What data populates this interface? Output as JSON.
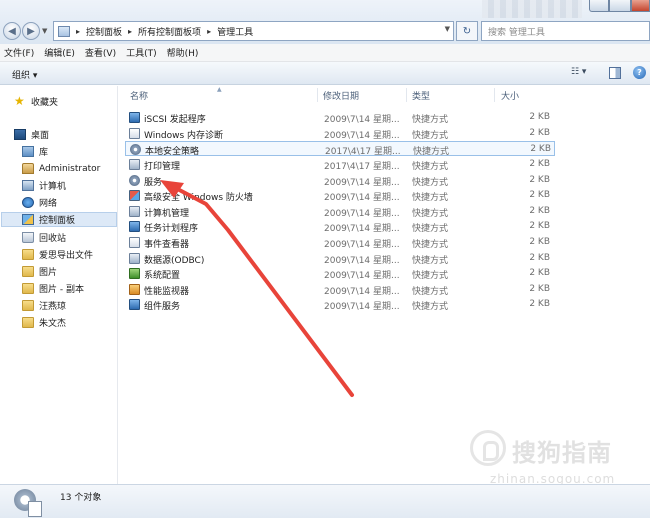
{
  "address": {
    "breadcrumbs": [
      "控制面板",
      "所有控制面板项",
      "管理工具"
    ],
    "search_placeholder": "搜索 管理工具"
  },
  "menu": [
    "文件(F)",
    "编辑(E)",
    "查看(V)",
    "工具(T)",
    "帮助(H)"
  ],
  "toolbar": {
    "organize_label": "组织 ▾"
  },
  "sidebar": {
    "items": [
      {
        "label": "收藏夹",
        "icon": "star-icon"
      },
      {
        "label": "桌面",
        "icon": "desktop-icon"
      },
      {
        "label": "库",
        "icon": "library-icon"
      },
      {
        "label": "Administrator",
        "icon": "user-folder-icon"
      },
      {
        "label": "计算机",
        "icon": "computer-icon"
      },
      {
        "label": "网络",
        "icon": "network-icon"
      },
      {
        "label": "控制面板",
        "icon": "control-panel-icon"
      },
      {
        "label": "回收站",
        "icon": "recycle-bin-icon"
      },
      {
        "label": "爱思导出文件",
        "icon": "folder-icon"
      },
      {
        "label": "图片",
        "icon": "folder-icon"
      },
      {
        "label": "图片 - 副本",
        "icon": "folder-icon"
      },
      {
        "label": "汪燕琼",
        "icon": "folder-icon"
      },
      {
        "label": "朱文杰",
        "icon": "folder-icon"
      }
    ]
  },
  "columns": [
    "名称",
    "修改日期",
    "类型",
    "大小"
  ],
  "files": [
    {
      "name": "iSCSI 发起程序",
      "date": "2009\\7\\14 星期...",
      "type": "快捷方式",
      "size": "2 KB",
      "icon": "iscsi-icon"
    },
    {
      "name": "Windows 内存诊断",
      "date": "2009\\7\\14 星期...",
      "type": "快捷方式",
      "size": "2 KB",
      "icon": "memory-diagnostic-icon"
    },
    {
      "name": "本地安全策略",
      "date": "2017\\4\\17 星期...",
      "type": "快捷方式",
      "size": "2 KB",
      "icon": "security-policy-icon"
    },
    {
      "name": "打印管理",
      "date": "2017\\4\\17 星期...",
      "type": "快捷方式",
      "size": "2 KB",
      "icon": "print-management-icon"
    },
    {
      "name": "服务",
      "date": "2009\\7\\14 星期...",
      "type": "快捷方式",
      "size": "2 KB",
      "icon": "services-icon"
    },
    {
      "name": "高级安全 Windows 防火墙",
      "date": "2009\\7\\14 星期...",
      "type": "快捷方式",
      "size": "2 KB",
      "icon": "firewall-icon"
    },
    {
      "name": "计算机管理",
      "date": "2009\\7\\14 星期...",
      "type": "快捷方式",
      "size": "2 KB",
      "icon": "computer-management-icon"
    },
    {
      "name": "任务计划程序",
      "date": "2009\\7\\14 星期...",
      "type": "快捷方式",
      "size": "2 KB",
      "icon": "task-scheduler-icon"
    },
    {
      "name": "事件查看器",
      "date": "2009\\7\\14 星期...",
      "type": "快捷方式",
      "size": "2 KB",
      "icon": "event-viewer-icon"
    },
    {
      "name": "数据源(ODBC)",
      "date": "2009\\7\\14 星期...",
      "type": "快捷方式",
      "size": "2 KB",
      "icon": "odbc-icon"
    },
    {
      "name": "系统配置",
      "date": "2009\\7\\14 星期...",
      "type": "快捷方式",
      "size": "2 KB",
      "icon": "system-config-icon"
    },
    {
      "name": "性能监视器",
      "date": "2009\\7\\14 星期...",
      "type": "快捷方式",
      "size": "2 KB",
      "icon": "performance-monitor-icon"
    },
    {
      "name": "组件服务",
      "date": "2009\\7\\14 星期...",
      "type": "快捷方式",
      "size": "2 KB",
      "icon": "component-services-icon"
    }
  ],
  "status": {
    "count_text": "13 个对象"
  },
  "watermark": {
    "text": "搜狗指南",
    "url": "zhinan.sogou.com"
  },
  "colors": {
    "arrow": "#e8443a",
    "selection": "#dde9f7",
    "highlight_border": "#99c0e8"
  }
}
